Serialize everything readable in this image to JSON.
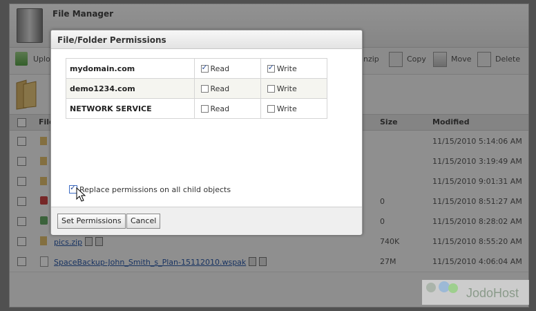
{
  "app": {
    "title": "File Manager"
  },
  "toolbar": {
    "upload_label": "Uploa",
    "unzip_label": "nzip",
    "copy_label": "Copy",
    "move_label": "Move",
    "delete_label": "Delete"
  },
  "table": {
    "col_file": "File",
    "col_size": "Size",
    "col_modified": "Modified",
    "rows": [
      {
        "name": "",
        "size": "",
        "modified": "11/15/2010 5:14:06 AM"
      },
      {
        "name": "",
        "size": "",
        "modified": "11/15/2010 3:19:49 AM"
      },
      {
        "name": "",
        "size": "",
        "modified": "11/15/2010 9:01:31 AM"
      },
      {
        "name": "",
        "size": "0",
        "modified": "11/15/2010 8:51:27 AM"
      },
      {
        "name": "",
        "size": "0",
        "modified": "11/15/2010 8:28:02 AM"
      },
      {
        "name": "pics.zip",
        "size": "740K",
        "modified": "11/15/2010 8:55:20 AM"
      },
      {
        "name": "SpaceBackup-John_Smith_s_Plan-15112010.wspak",
        "size": "27M",
        "modified": "11/15/2010 4:06:04 AM"
      }
    ]
  },
  "dialog": {
    "title": "File/Folder Permissions",
    "users": [
      {
        "name": "mydomain.com",
        "read": true,
        "write": true
      },
      {
        "name": "demo1234.com",
        "read": false,
        "write": false
      },
      {
        "name": "NETWORK SERVICE",
        "read": false,
        "write": false
      }
    ],
    "read_label": "Read",
    "write_label": "Write",
    "replace_label": "Replace permissions on all child objects",
    "replace_checked": true,
    "set_button": "Set Permissions",
    "cancel_button": "Cancel"
  },
  "watermark": {
    "brand": "JodoHost"
  }
}
